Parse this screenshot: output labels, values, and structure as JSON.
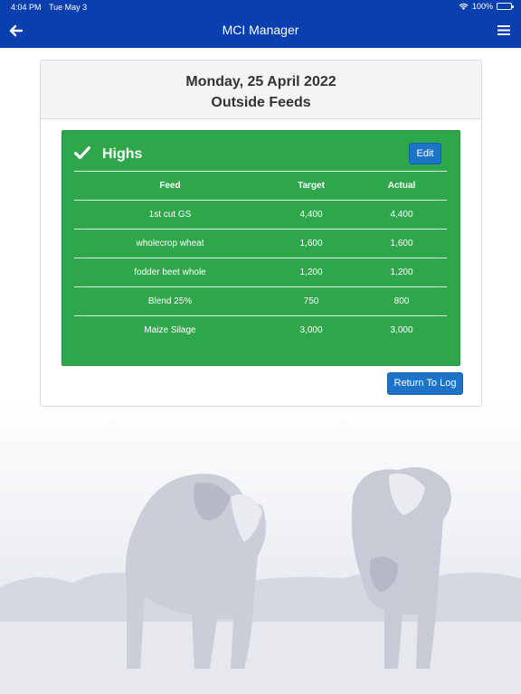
{
  "status_bar": {
    "time": "4:04 PM",
    "date": "Tue May 3",
    "battery": "100%"
  },
  "nav": {
    "title": "MCI Manager",
    "back_icon": "arrow-left-icon",
    "menu_icon": "hamburger-menu-icon",
    "color": "#0a3fb0"
  },
  "card": {
    "date": "Monday, 25 April 2022",
    "subtitle": "Outside Feeds"
  },
  "group": {
    "title": "Highs",
    "status_icon": "check-icon",
    "edit_label": "Edit",
    "color": "#2ea64a"
  },
  "table": {
    "headers": [
      "Feed",
      "Target",
      "Actual"
    ],
    "rows": [
      [
        "1st cut GS",
        "4,400",
        "4,400"
      ],
      [
        "wholecrop wheat",
        "1,600",
        "1,600"
      ],
      [
        "fodder beet whole",
        "1,200",
        "1,200"
      ],
      [
        "Blend 25%",
        "750",
        "800"
      ],
      [
        "Maize Silage",
        "3,000",
        "3,000"
      ]
    ]
  },
  "return_label": "Return To Log"
}
